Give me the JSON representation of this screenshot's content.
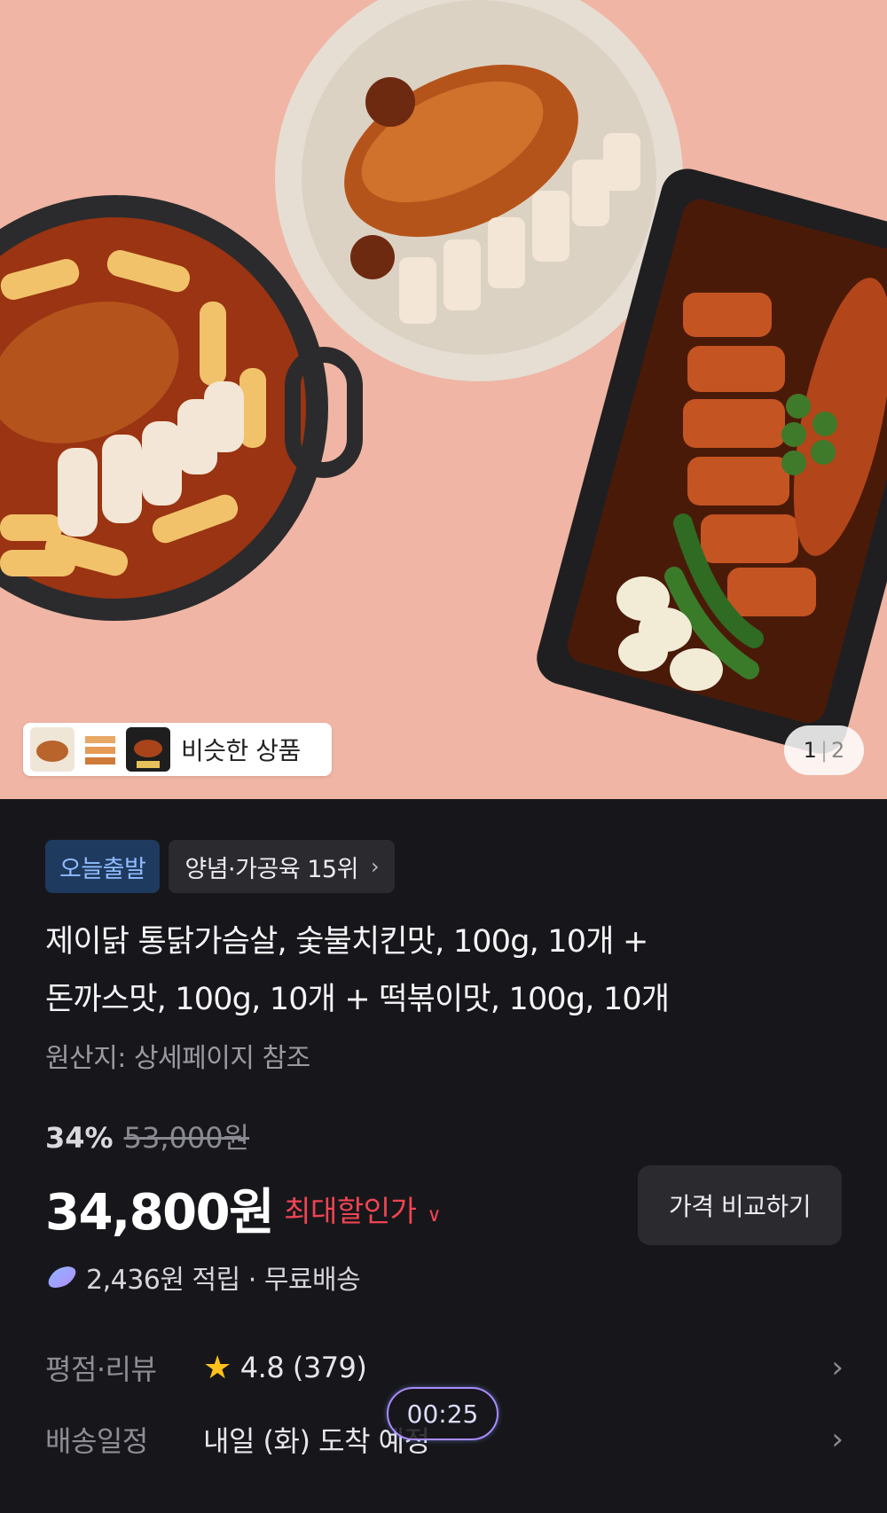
{
  "hero": {
    "similar_label": "비슷한 상품",
    "pager_current": "1",
    "pager_separator": "|",
    "pager_total": "2",
    "background_color": "#f0b5a4"
  },
  "badges": {
    "today_label": "오늘출발",
    "rank_label": "양념·가공육 15위"
  },
  "product": {
    "title_line1": "제이닭 통닭가슴살, 숯불치킨맛, 100g, 10개 +",
    "title_line2": "돈까스맛, 100g, 10개 + 떡볶이맛, 100g, 10개",
    "origin": "원산지: 상세페이지 참조"
  },
  "pricing": {
    "discount_rate": "34%",
    "original_price": "53,000원",
    "price": "34,800원",
    "max_discount_label": "최대할인가",
    "compare_button": "가격 비교하기",
    "reward_text": "2,436원 적립 · 무료배송",
    "accent_red": "#f04452"
  },
  "rows": {
    "rating_label": "평점·리뷰",
    "rating_value": "4.8 (379)",
    "delivery_label": "배송일정",
    "delivery_value": "내일 (화) 도착 예정"
  },
  "timer": "00:25",
  "icons": {
    "star": "star-icon",
    "chevron": "chevron-right-icon",
    "dropdown": "chevron-down-icon",
    "gem": "gem-icon"
  }
}
